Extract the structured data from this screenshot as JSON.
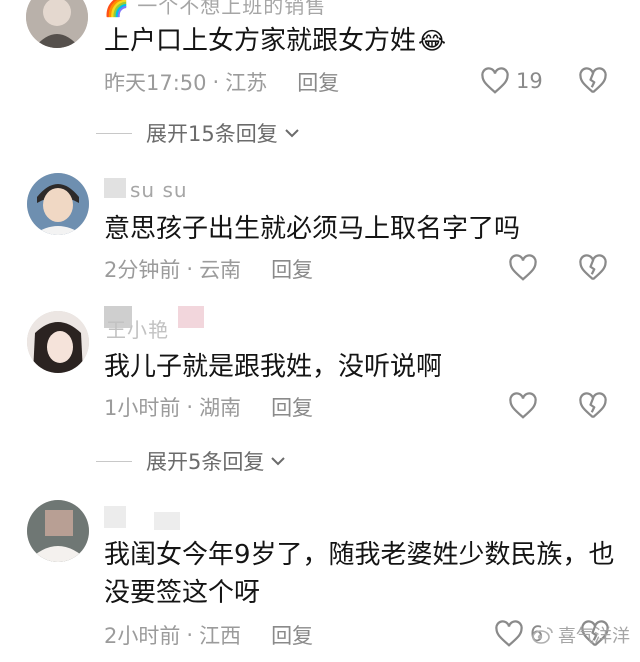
{
  "comments": [
    {
      "username": "一个不想上班的销售",
      "text": "上户口上女方家就跟女方姓",
      "emoji": "😂",
      "time": "昨天17:50",
      "location": "江苏",
      "reply_label": "回复",
      "like_count": "19"
    },
    {
      "username": "su su",
      "text": "意思孩子出生就必须马上取名字了吗",
      "time": "2分钟前",
      "location": "云南",
      "reply_label": "回复"
    },
    {
      "username": "王小艳",
      "text": "我儿子就是跟我姓，没听说啊",
      "time": "1小时前",
      "location": "湖南",
      "reply_label": "回复"
    },
    {
      "text_line1": "我闺女今年9岁了，随我老婆姓少数民族，也",
      "text_line2": "没要签这个呀",
      "time": "2小时前",
      "location": "江西",
      "reply_label": "回复",
      "like_count": "6"
    }
  ],
  "expand_replies": [
    {
      "label": "展开15条回复"
    },
    {
      "label": "展开5条回复"
    }
  ],
  "separator": "·",
  "watermark": "喜气洋洋",
  "icons": {
    "like": "heart-outline-icon",
    "dislike": "broken-heart-icon",
    "expand": "chevron-down-icon",
    "watermark": "weibo-logo-icon"
  },
  "colors": {
    "text": "#141414",
    "meta": "#9b9b9b",
    "icon": "#8a8a8a"
  }
}
